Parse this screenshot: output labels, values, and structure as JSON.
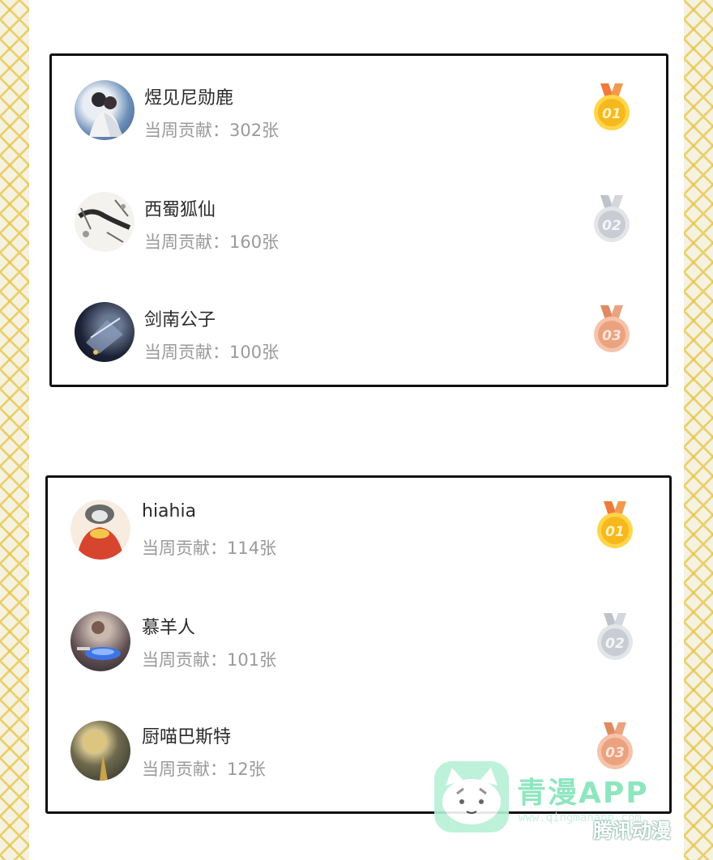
{
  "contribution_prefix": "当周贡献：",
  "lists": [
    {
      "entries": [
        {
          "rank": "01",
          "name": "煜见尼勋鹿",
          "contribution": "302张",
          "medal": "gold-medal"
        },
        {
          "rank": "02",
          "name": "西蜀狐仙",
          "contribution": "160张",
          "medal": "silver-medal"
        },
        {
          "rank": "03",
          "name": "剑南公子",
          "contribution": "100张",
          "medal": "bronze-medal"
        }
      ]
    },
    {
      "entries": [
        {
          "rank": "01",
          "name": "hiahia",
          "contribution": "114张",
          "medal": "gold-medal"
        },
        {
          "rank": "02",
          "name": "慕羊人",
          "contribution": "101张",
          "medal": "silver-medal"
        },
        {
          "rank": "03",
          "name": "厨喵巴斯特",
          "contribution": "12张",
          "medal": "bronze-medal"
        }
      ]
    }
  ],
  "watermark": {
    "title": "青漫APP",
    "url": "www.qingmanapp.com",
    "subtitle": "腾讯动漫"
  },
  "colors": {
    "gold": "#f6b81c",
    "silver": "#c9ccd3",
    "bronze": "#eba27f",
    "border": "#111111",
    "name_text": "#2a2a2a",
    "sub_text": "#9a9a9a"
  }
}
